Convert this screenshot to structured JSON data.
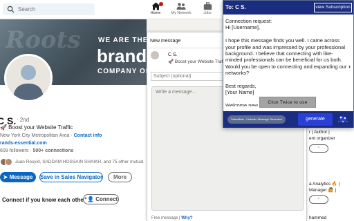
{
  "nav": {
    "search_placeholder": "Search",
    "items": [
      {
        "label": "Home",
        "icon": "home-icon"
      },
      {
        "label": "My Network",
        "icon": "people-icon"
      },
      {
        "label": "Jobs",
        "icon": "briefcase-icon"
      }
    ]
  },
  "banner": {
    "bg_logo": "Roots",
    "line1": "WE ARE THE",
    "line2": "brand",
    "line3": "COMPANY OF THE F"
  },
  "profile": {
    "name": "C S.",
    "degree": "· 2nd",
    "headline": "🚀 Boost your Website Traffic",
    "location": "New York City Metropolitan Area",
    "location_sep": " · ",
    "contact_info": "Contact info",
    "website": "rands-essential.com",
    "followers": "609 followers",
    "connections_sep": " · ",
    "connections": "500+ connections",
    "mutuals_text": "Juan Rosyid, SADDAM HOSSAIN SHAIKH, and 75 other mutual",
    "message_btn": "Message",
    "sales_btn": "Save in Sales Navigator",
    "more_btn": "More",
    "connect_prompt": "Connect if you know each other",
    "connect_btn": "Connect"
  },
  "compose": {
    "title": "New message",
    "recipient_name": "C S.",
    "recipient_headline": "🚀 Boost your Website Traffic",
    "subject_placeholder": "Subject (optional)",
    "message_placeholder": "Write a message…",
    "footer_text": "Free message | ",
    "footer_link": "Why?"
  },
  "extension": {
    "to_label": "To: C S.",
    "subscription_btn": "view Subscription",
    "message": "Connection request:\nHi [Username],\n\nI hope this message finds you well. I came across your profile and was impressed by your professional background. I believe that connecting with like-minded professionals can be beneficial for us both. Would you be open to connecting and expanding our networks?\n\nBest regards,\n[Your Name]\n\nWelcome new connection:\nDear [Username],",
    "click_twice": "Click Twice to use",
    "brand": "SalesMate - LinkedIn Message Generator",
    "generate_btn": "generate",
    "accent": "#1b2d80"
  },
  "right_column": {
    "line1": "r | Author |",
    "line2": "ent organizer",
    "line3": "a Analytics 🔥 |",
    "line4": "Manager 🙋 |",
    "line5": "hammed"
  }
}
